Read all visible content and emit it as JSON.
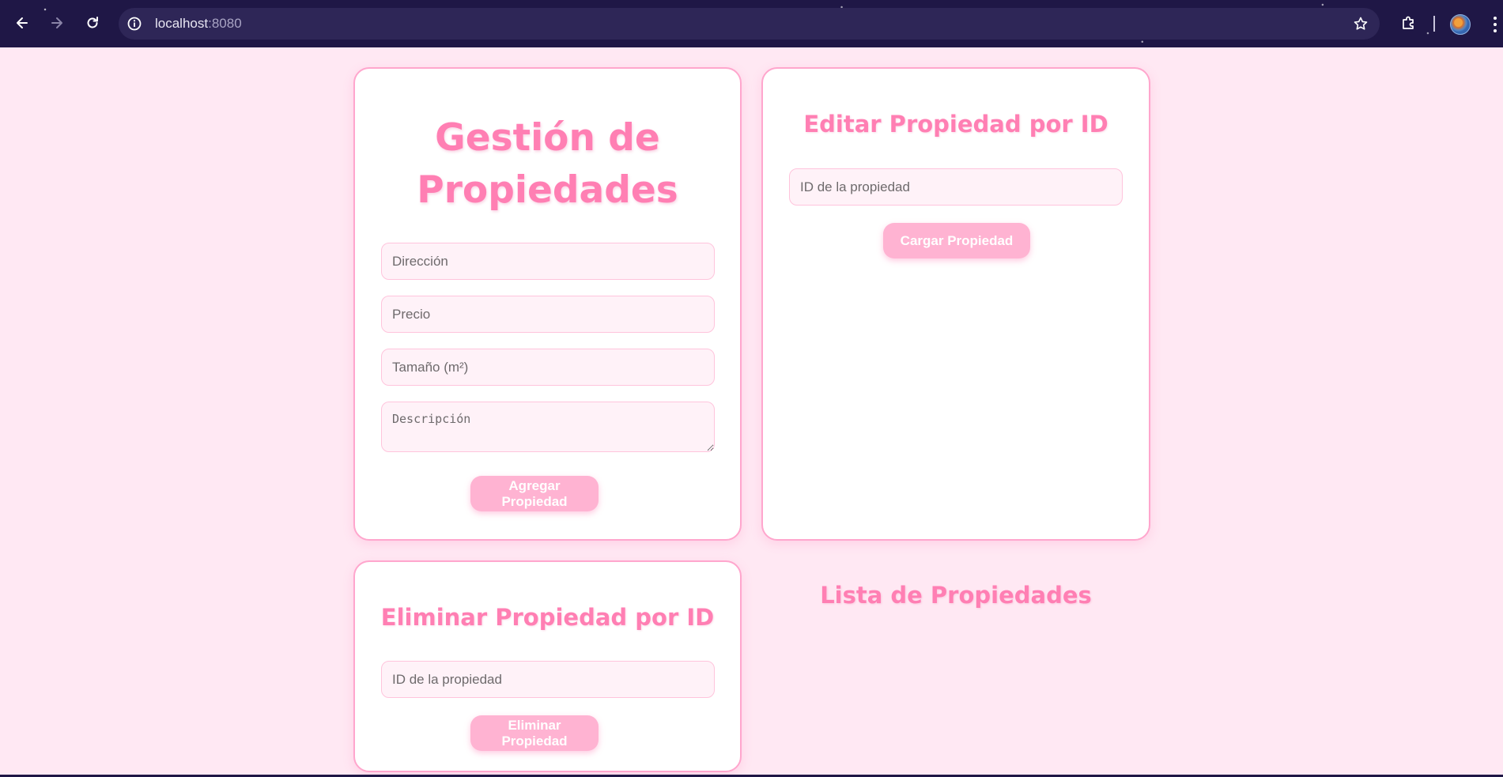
{
  "browser": {
    "url_host": "localhost",
    "url_port": ":8080",
    "icons": [
      "back-icon",
      "forward-icon",
      "reload-icon",
      "site-info-icon",
      "bookmark-star-icon",
      "extensions-icon",
      "profile-avatar",
      "more-menu-icon"
    ]
  },
  "add_form": {
    "title": "Gestión de Propiedades",
    "direccion_placeholder": "Dirección",
    "precio_placeholder": "Precio",
    "tamano_placeholder": "Tamaño (m²)",
    "descripcion_placeholder": "Descripción",
    "submit_label": "Agregar Propiedad"
  },
  "edit_form": {
    "title": "Editar Propiedad por ID",
    "id_placeholder": "ID de la propiedad",
    "submit_label": "Cargar Propiedad"
  },
  "delete_form": {
    "title": "Eliminar Propiedad por ID",
    "id_placeholder": "ID de la propiedad",
    "submit_label": "Eliminar Propiedad"
  },
  "list": {
    "title": "Lista de Propiedades"
  },
  "colors": {
    "accent": "#ff7fb3",
    "button": "#ffb3d2",
    "page_bg": "#ffe8f3",
    "card_border": "#ffa6cd"
  }
}
